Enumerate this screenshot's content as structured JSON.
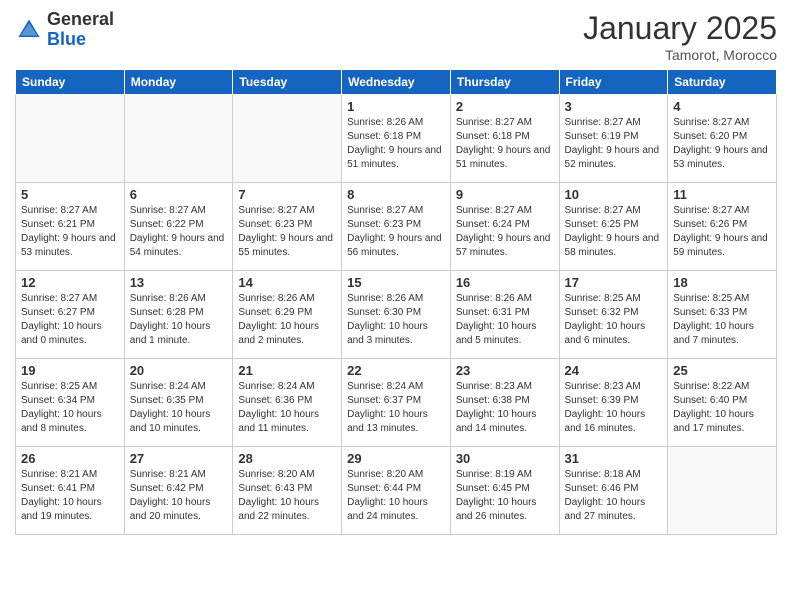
{
  "logo": {
    "general": "General",
    "blue": "Blue"
  },
  "title": {
    "month_year": "January 2025",
    "location": "Tamorot, Morocco"
  },
  "headers": [
    "Sunday",
    "Monday",
    "Tuesday",
    "Wednesday",
    "Thursday",
    "Friday",
    "Saturday"
  ],
  "weeks": [
    [
      {
        "day": "",
        "info": ""
      },
      {
        "day": "",
        "info": ""
      },
      {
        "day": "",
        "info": ""
      },
      {
        "day": "1",
        "info": "Sunrise: 8:26 AM\nSunset: 6:18 PM\nDaylight: 9 hours\nand 51 minutes."
      },
      {
        "day": "2",
        "info": "Sunrise: 8:27 AM\nSunset: 6:18 PM\nDaylight: 9 hours\nand 51 minutes."
      },
      {
        "day": "3",
        "info": "Sunrise: 8:27 AM\nSunset: 6:19 PM\nDaylight: 9 hours\nand 52 minutes."
      },
      {
        "day": "4",
        "info": "Sunrise: 8:27 AM\nSunset: 6:20 PM\nDaylight: 9 hours\nand 53 minutes."
      }
    ],
    [
      {
        "day": "5",
        "info": "Sunrise: 8:27 AM\nSunset: 6:21 PM\nDaylight: 9 hours\nand 53 minutes."
      },
      {
        "day": "6",
        "info": "Sunrise: 8:27 AM\nSunset: 6:22 PM\nDaylight: 9 hours\nand 54 minutes."
      },
      {
        "day": "7",
        "info": "Sunrise: 8:27 AM\nSunset: 6:23 PM\nDaylight: 9 hours\nand 55 minutes."
      },
      {
        "day": "8",
        "info": "Sunrise: 8:27 AM\nSunset: 6:23 PM\nDaylight: 9 hours\nand 56 minutes."
      },
      {
        "day": "9",
        "info": "Sunrise: 8:27 AM\nSunset: 6:24 PM\nDaylight: 9 hours\nand 57 minutes."
      },
      {
        "day": "10",
        "info": "Sunrise: 8:27 AM\nSunset: 6:25 PM\nDaylight: 9 hours\nand 58 minutes."
      },
      {
        "day": "11",
        "info": "Sunrise: 8:27 AM\nSunset: 6:26 PM\nDaylight: 9 hours\nand 59 minutes."
      }
    ],
    [
      {
        "day": "12",
        "info": "Sunrise: 8:27 AM\nSunset: 6:27 PM\nDaylight: 10 hours\nand 0 minutes."
      },
      {
        "day": "13",
        "info": "Sunrise: 8:26 AM\nSunset: 6:28 PM\nDaylight: 10 hours\nand 1 minute."
      },
      {
        "day": "14",
        "info": "Sunrise: 8:26 AM\nSunset: 6:29 PM\nDaylight: 10 hours\nand 2 minutes."
      },
      {
        "day": "15",
        "info": "Sunrise: 8:26 AM\nSunset: 6:30 PM\nDaylight: 10 hours\nand 3 minutes."
      },
      {
        "day": "16",
        "info": "Sunrise: 8:26 AM\nSunset: 6:31 PM\nDaylight: 10 hours\nand 5 minutes."
      },
      {
        "day": "17",
        "info": "Sunrise: 8:25 AM\nSunset: 6:32 PM\nDaylight: 10 hours\nand 6 minutes."
      },
      {
        "day": "18",
        "info": "Sunrise: 8:25 AM\nSunset: 6:33 PM\nDaylight: 10 hours\nand 7 minutes."
      }
    ],
    [
      {
        "day": "19",
        "info": "Sunrise: 8:25 AM\nSunset: 6:34 PM\nDaylight: 10 hours\nand 8 minutes."
      },
      {
        "day": "20",
        "info": "Sunrise: 8:24 AM\nSunset: 6:35 PM\nDaylight: 10 hours\nand 10 minutes."
      },
      {
        "day": "21",
        "info": "Sunrise: 8:24 AM\nSunset: 6:36 PM\nDaylight: 10 hours\nand 11 minutes."
      },
      {
        "day": "22",
        "info": "Sunrise: 8:24 AM\nSunset: 6:37 PM\nDaylight: 10 hours\nand 13 minutes."
      },
      {
        "day": "23",
        "info": "Sunrise: 8:23 AM\nSunset: 6:38 PM\nDaylight: 10 hours\nand 14 minutes."
      },
      {
        "day": "24",
        "info": "Sunrise: 8:23 AM\nSunset: 6:39 PM\nDaylight: 10 hours\nand 16 minutes."
      },
      {
        "day": "25",
        "info": "Sunrise: 8:22 AM\nSunset: 6:40 PM\nDaylight: 10 hours\nand 17 minutes."
      }
    ],
    [
      {
        "day": "26",
        "info": "Sunrise: 8:21 AM\nSunset: 6:41 PM\nDaylight: 10 hours\nand 19 minutes."
      },
      {
        "day": "27",
        "info": "Sunrise: 8:21 AM\nSunset: 6:42 PM\nDaylight: 10 hours\nand 20 minutes."
      },
      {
        "day": "28",
        "info": "Sunrise: 8:20 AM\nSunset: 6:43 PM\nDaylight: 10 hours\nand 22 minutes."
      },
      {
        "day": "29",
        "info": "Sunrise: 8:20 AM\nSunset: 6:44 PM\nDaylight: 10 hours\nand 24 minutes."
      },
      {
        "day": "30",
        "info": "Sunrise: 8:19 AM\nSunset: 6:45 PM\nDaylight: 10 hours\nand 26 minutes."
      },
      {
        "day": "31",
        "info": "Sunrise: 8:18 AM\nSunset: 6:46 PM\nDaylight: 10 hours\nand 27 minutes."
      },
      {
        "day": "",
        "info": ""
      }
    ]
  ]
}
